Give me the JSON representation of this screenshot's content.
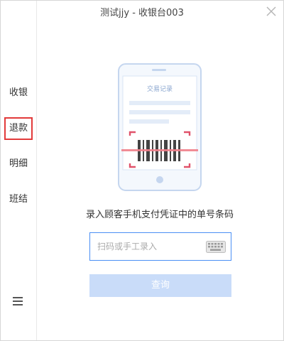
{
  "window": {
    "title": "测试jjy - 收银台003"
  },
  "sidebar": {
    "items": [
      {
        "label": "收银"
      },
      {
        "label": "退款"
      },
      {
        "label": "明细"
      },
      {
        "label": "班结"
      }
    ],
    "active": "退款",
    "menu_icon": "hamburger-menu-icon"
  },
  "illustration": {
    "screen_title": "交易记录"
  },
  "main": {
    "prompt": "录入顾客手机支付凭证中的单号条码",
    "input": {
      "value": "",
      "placeholder": "扫码或手工录入"
    },
    "query_button": "查询"
  },
  "colors": {
    "accent": "#4a8ff5",
    "active_border": "#e23a3a",
    "button_disabled": "#c9dcf9",
    "scan_line": "#f07f8b"
  }
}
